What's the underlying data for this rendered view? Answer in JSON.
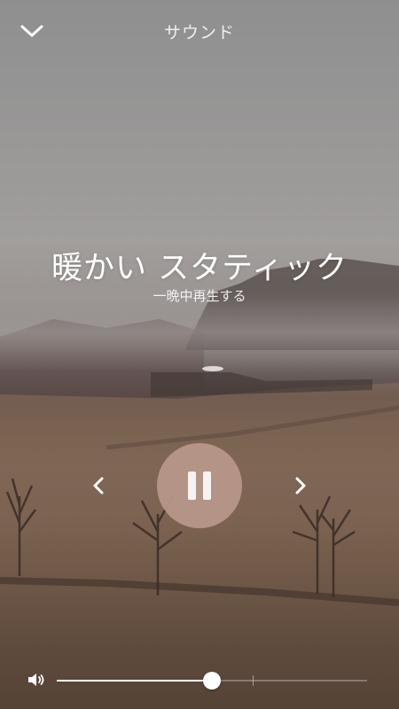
{
  "header": {
    "title": "サウンド",
    "collapse_icon": "chevron-down-icon"
  },
  "track": {
    "title": "暖かい スタティック",
    "subtitle": "一晩中再生する"
  },
  "controls": {
    "previous_icon": "chevron-left-icon",
    "next_icon": "chevron-right-icon",
    "play_state_icon": "pause-icon",
    "play_button_color": "#b9988a"
  },
  "volume": {
    "icon": "speaker-icon",
    "level": 0.5
  }
}
